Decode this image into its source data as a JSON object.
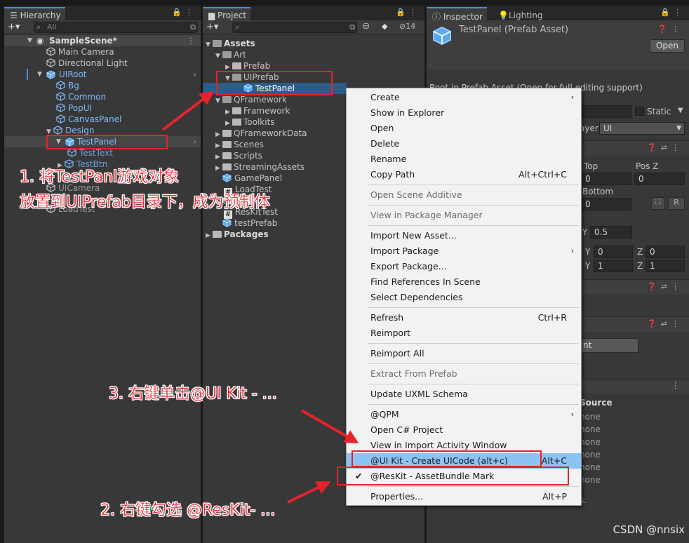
{
  "hierarchy": {
    "tab": "Hierarchy",
    "search_placeholder": "All",
    "scene": "SampleScene*",
    "items": [
      {
        "label": "Main Camera"
      },
      {
        "label": "Directional Light"
      },
      {
        "label": "UIRoot"
      },
      {
        "label": "Bg"
      },
      {
        "label": "Common"
      },
      {
        "label": "PopUI"
      },
      {
        "label": "CanvasPanel"
      },
      {
        "label": "Design"
      },
      {
        "label": "TestPanel"
      },
      {
        "label": "TestText"
      },
      {
        "label": "TestBtn"
      },
      {
        "label": "UICamera"
      },
      {
        "label": "LoadTest"
      }
    ]
  },
  "project": {
    "tab": "Project",
    "count": "14",
    "items": [
      {
        "label": "Assets"
      },
      {
        "label": "Art"
      },
      {
        "label": "Prefab"
      },
      {
        "label": "UIPrefab"
      },
      {
        "label": "TestPanel"
      },
      {
        "label": "QFramework"
      },
      {
        "label": "Framework"
      },
      {
        "label": "Toolkits"
      },
      {
        "label": "QFrameworkData"
      },
      {
        "label": "Scenes"
      },
      {
        "label": "Scripts"
      },
      {
        "label": "StreamingAssets"
      },
      {
        "label": "GamePanel"
      },
      {
        "label": "LoadTest"
      },
      {
        "label": "ResKit"
      },
      {
        "label": "ResKitTest"
      },
      {
        "label": "testPrefab"
      },
      {
        "label": "Packages"
      }
    ]
  },
  "inspector": {
    "tab": "Inspector",
    "tab2": "Lighting",
    "title": "TestPanel (Prefab Asset)",
    "open_button": "Open",
    "root_msg": "Root in Prefab Asset (Open for full editing support)",
    "static_label": "Static",
    "layer_label": "ayer",
    "layer_value": "UI",
    "top_label": "Top",
    "top_value": "0",
    "posz_label": "Pos Z",
    "posz_value": "0",
    "bottom_label": "Bottom",
    "bottom_value": "0",
    "r_label": "R",
    "pivot_y_label": "Y",
    "pivot_y_value": "0.5",
    "rot_y_label": "Y",
    "rot_y_value": "0",
    "rot_z_label": "Z",
    "rot_z_value": "0",
    "scale_y_label": "Y",
    "scale_y_value": "1",
    "scale_z_label": "Z",
    "scale_z_value": "1",
    "nt_button": "nt",
    "source_label": "Source",
    "none_values": [
      "none",
      "none",
      "none",
      "none",
      "none",
      "none"
    ],
    "trailing": "s."
  },
  "context_menu": {
    "items": [
      {
        "label": "Create"
      },
      {
        "label": "Show in Explorer"
      },
      {
        "label": "Open"
      },
      {
        "label": "Delete"
      },
      {
        "label": "Rename"
      },
      {
        "label": "Copy Path",
        "shortcut": "Alt+Ctrl+C"
      },
      {
        "label": "Open Scene Additive"
      },
      {
        "label": "View in Package Manager"
      },
      {
        "label": "Import New Asset..."
      },
      {
        "label": "Import Package"
      },
      {
        "label": "Export Package..."
      },
      {
        "label": "Find References In Scene"
      },
      {
        "label": "Select Dependencies"
      },
      {
        "label": "Refresh",
        "shortcut": "Ctrl+R"
      },
      {
        "label": "Reimport"
      },
      {
        "label": "Reimport All"
      },
      {
        "label": "Extract From Prefab"
      },
      {
        "label": "Update UXML Schema"
      },
      {
        "label": "@QPM"
      },
      {
        "label": "Open C# Project"
      },
      {
        "label": "View in Import Activity Window"
      },
      {
        "label": "@UI Kit - Create UICode (alt+c)",
        "shortcut": "Alt+C"
      },
      {
        "label": "@ResKit - AssetBundle Mark"
      },
      {
        "label": "Properties...",
        "shortcut": "Alt+P"
      }
    ]
  },
  "annotations": {
    "step1_line1": "1. 将TestPanl游戏对象",
    "step1_line2": "放置到UIPrefab目录下，成为预制体",
    "step2": "2. 右键勾选 @ResKit- ...",
    "step3": "3. 右键单击@UI Kit - ..."
  },
  "watermark": "CSDN @nnsix",
  "colors": {
    "prefab_text": "#7fbaff",
    "selection": "#2c5d87",
    "menu_hover": "#8cc3f5",
    "annotation_red": "#e8232d"
  }
}
